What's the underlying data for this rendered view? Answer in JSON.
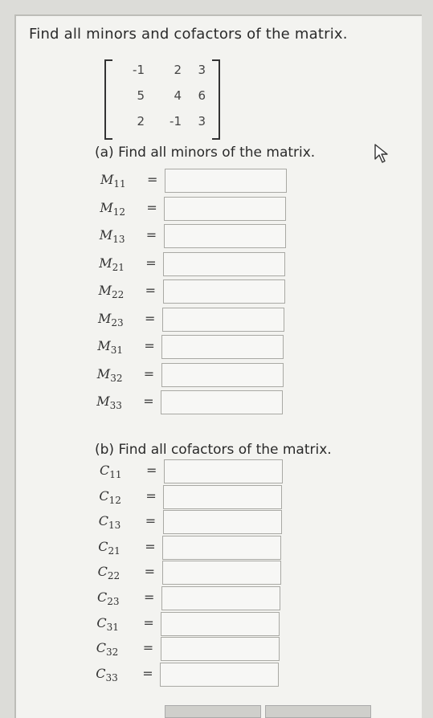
{
  "question": "Find all minors and cofactors of the matrix.",
  "matrix": [
    [
      "-1",
      "2",
      "3"
    ],
    [
      "5",
      "4",
      "6"
    ],
    [
      "2",
      "-1",
      "3"
    ]
  ],
  "part_a": {
    "title": "(a) Find all minors of the matrix.",
    "rows": [
      {
        "sym": "M",
        "sub": "11"
      },
      {
        "sym": "M",
        "sub": "12"
      },
      {
        "sym": "M",
        "sub": "13"
      },
      {
        "sym": "M",
        "sub": "21"
      },
      {
        "sym": "M",
        "sub": "22"
      },
      {
        "sym": "M",
        "sub": "23"
      },
      {
        "sym": "M",
        "sub": "31"
      },
      {
        "sym": "M",
        "sub": "32"
      },
      {
        "sym": "M",
        "sub": "33"
      }
    ]
  },
  "part_b": {
    "title": "(b) Find all cofactors of the matrix.",
    "rows": [
      {
        "sym": "C",
        "sub": "11"
      },
      {
        "sym": "C",
        "sub": "12"
      },
      {
        "sym": "C",
        "sub": "13"
      },
      {
        "sym": "C",
        "sub": "21"
      },
      {
        "sym": "C",
        "sub": "22"
      },
      {
        "sym": "C",
        "sub": "23"
      },
      {
        "sym": "C",
        "sub": "31"
      },
      {
        "sym": "C",
        "sub": "32"
      },
      {
        "sym": "C",
        "sub": "33"
      }
    ]
  },
  "equals": "=",
  "icons": {
    "cursor": "mouse-pointer-icon"
  }
}
